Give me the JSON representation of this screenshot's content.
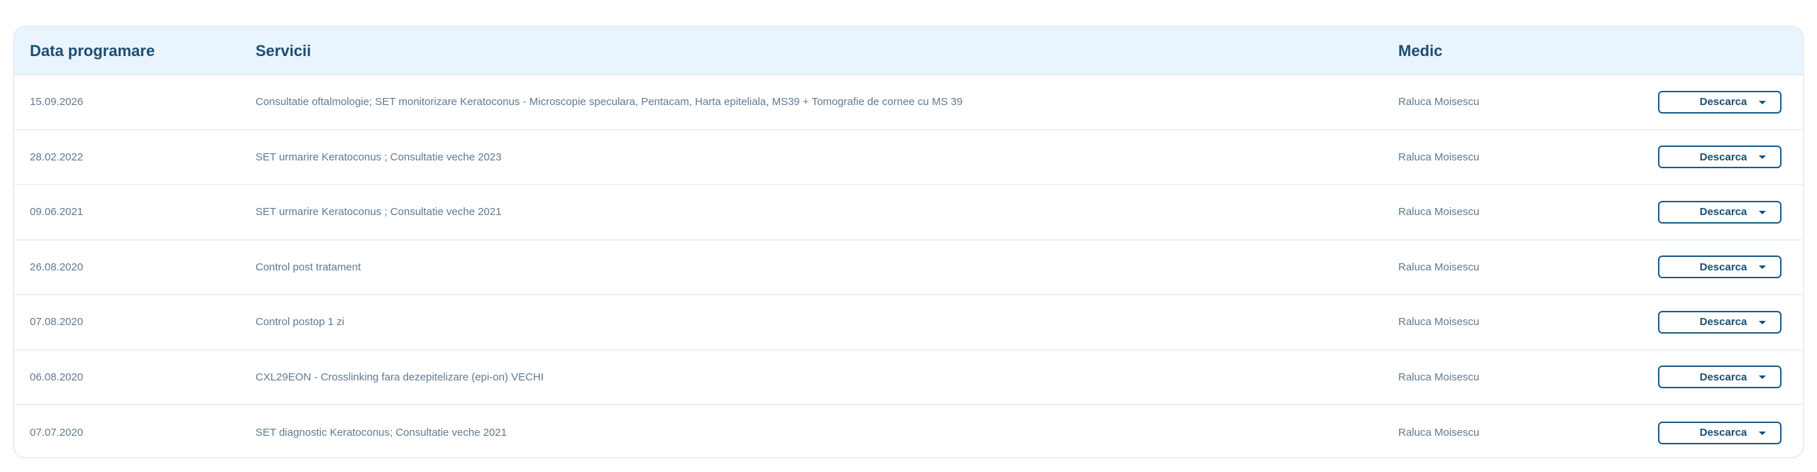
{
  "table": {
    "headers": {
      "date": "Data programare",
      "services": "Servicii",
      "doctor": "Medic"
    },
    "download_label": "Descarca",
    "rows": [
      {
        "date": "15.09.2026",
        "services": "Consultatie oftalmologie; SET monitorizare Keratoconus - Microscopie speculara, Pentacam, Harta epiteliala, MS39 + Tomografie de cornee cu MS 39",
        "doctor": "Raluca Moisescu"
      },
      {
        "date": "28.02.2022",
        "services": "SET urmarire Keratoconus ; Consultatie veche 2023",
        "doctor": "Raluca Moisescu"
      },
      {
        "date": "09.06.2021",
        "services": "SET urmarire Keratoconus ; Consultatie veche 2021",
        "doctor": "Raluca Moisescu"
      },
      {
        "date": "26.08.2020",
        "services": "Control post tratament",
        "doctor": "Raluca Moisescu"
      },
      {
        "date": "07.08.2020",
        "services": "Control postop 1 zi",
        "doctor": "Raluca Moisescu"
      },
      {
        "date": "06.08.2020",
        "services": "CXL29EON - Crosslinking fara dezepitelizare (epi-on) VECHI",
        "doctor": "Raluca Moisescu"
      },
      {
        "date": "07.07.2020",
        "services": "SET diagnostic Keratoconus; Consultatie veche 2021",
        "doctor": "Raluca Moisescu"
      }
    ]
  }
}
